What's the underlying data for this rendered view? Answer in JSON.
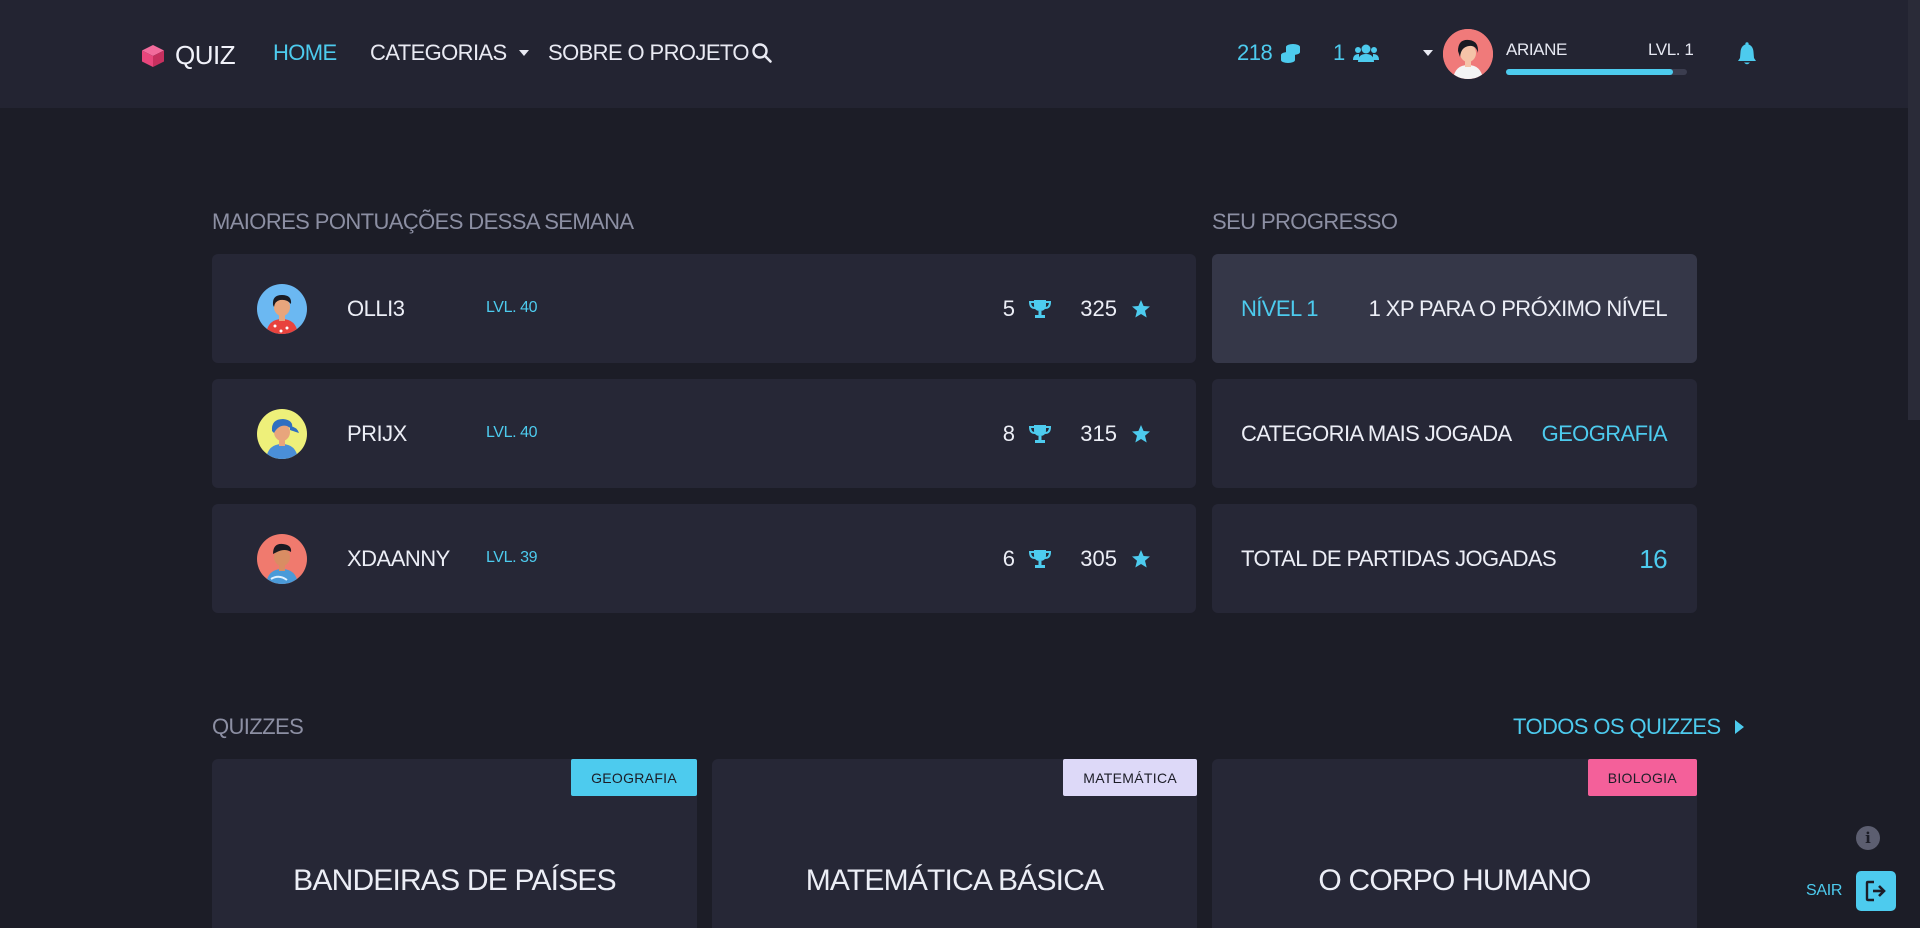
{
  "header": {
    "logo_text": "QUIZ",
    "nav": {
      "home": "HOME",
      "categories": "CATEGORIAS",
      "about": "SOBRE O PROJETO"
    },
    "coins": "218",
    "friends": "1",
    "user": {
      "name": "ARIANE",
      "level": "LVL. 1",
      "xp_progress": 0.92
    }
  },
  "leaderboard": {
    "title": "MAIORES PONTUAÇÕES DESSA SEMANA",
    "rows": [
      {
        "name": "OLLI3",
        "level": "LVL. 40",
        "trophies": "5",
        "points": "325"
      },
      {
        "name": "PRIJX",
        "level": "LVL. 40",
        "trophies": "8",
        "points": "315"
      },
      {
        "name": "XDAANNY",
        "level": "LVL. 39",
        "trophies": "6",
        "points": "305"
      }
    ]
  },
  "progress": {
    "title": "SEU PROGRESSO",
    "level_label": "NÍVEL 1",
    "next_level": "1 XP PARA O PRÓXIMO NÍVEL",
    "most_played_label": "CATEGORIA MAIS JOGADA",
    "most_played_value": "GEOGRAFIA",
    "total_label": "TOTAL DE PARTIDAS JOGADAS",
    "total_value": "16"
  },
  "quizzes": {
    "title": "QUIZZES",
    "all_link": "TODOS OS QUIZZES",
    "items": [
      {
        "category": "GEOGRAFIA",
        "title": "BANDEIRAS DE PAÍSES",
        "badge_color": "#4dcbee"
      },
      {
        "category": "MATEMÁTICA",
        "title": "MATEMÁTICA BÁSICA",
        "badge_color": "#ddd9f8"
      },
      {
        "category": "BIOLOGIA",
        "title": "O CORPO HUMANO",
        "badge_color": "#f4609a"
      }
    ]
  },
  "footer": {
    "logout_label": "SAIR"
  },
  "colors": {
    "accent": "#4dcbee",
    "background": "#1c1d27",
    "card": "#262736",
    "logo": "#e8467c"
  }
}
